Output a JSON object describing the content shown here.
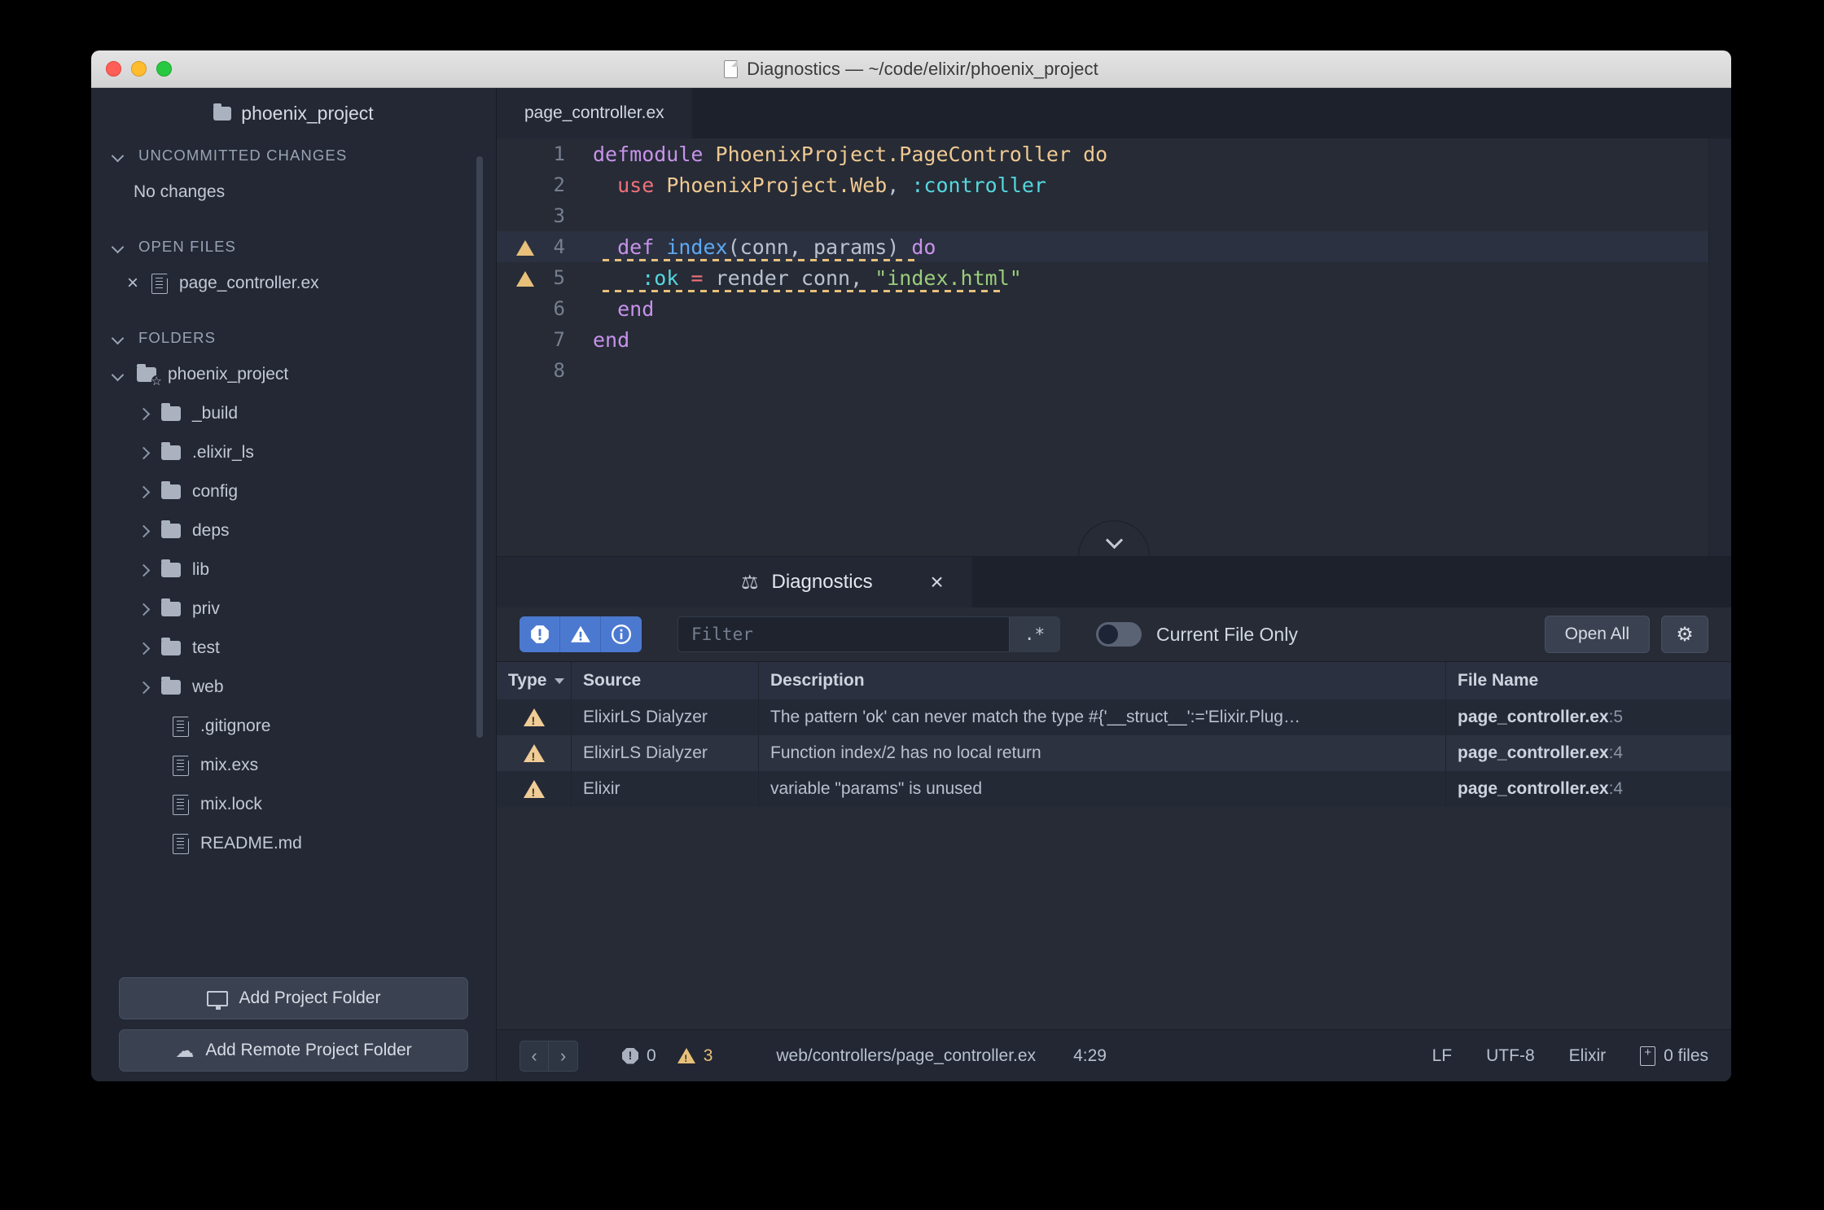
{
  "window": {
    "title": "Diagnostics — ~/code/elixir/phoenix_project",
    "traffic": {
      "close": "close",
      "minimize": "minimize",
      "zoom": "zoom"
    }
  },
  "sidebar": {
    "project_name": "phoenix_project",
    "sections": [
      {
        "label": "UNCOMMITTED CHANGES",
        "empty_text": "No changes"
      },
      {
        "label": "OPEN FILES"
      },
      {
        "label": "FOLDERS"
      }
    ],
    "open_files": [
      {
        "name": "page_controller.ex",
        "close": "×"
      }
    ],
    "root_folder": "phoenix_project",
    "folders": [
      "_build",
      ".elixir_ls",
      "config",
      "deps",
      "lib",
      "priv",
      "test",
      "web"
    ],
    "files": [
      ".gitignore",
      "mix.exs",
      "mix.lock",
      "README.md"
    ],
    "buttons": [
      {
        "label": "Add Project Folder",
        "icon": "monitor-icon"
      },
      {
        "label": "Add Remote Project Folder",
        "icon": "cloud-upload-icon"
      }
    ]
  },
  "editor": {
    "tabs": [
      {
        "label": "page_controller.ex",
        "active": true
      }
    ],
    "lines": [
      {
        "n": "1",
        "marker": "",
        "highlight": false,
        "tokens": [
          {
            "t": "defmodule ",
            "c": "tok-kw"
          },
          {
            "t": "PhoenixProject.PageController",
            "c": "tok-mod"
          },
          {
            "t": " ",
            "c": "tok-punc"
          },
          {
            "t": "do",
            "c": "tok-mod"
          }
        ]
      },
      {
        "n": "2",
        "marker": "",
        "highlight": false,
        "tokens": [
          {
            "t": "  ",
            "c": "tok-punc"
          },
          {
            "t": "use ",
            "c": "tok-use"
          },
          {
            "t": "PhoenixProject.Web",
            "c": "tok-mod"
          },
          {
            "t": ", ",
            "c": "tok-punc"
          },
          {
            "t": ":controller",
            "c": "tok-atom"
          }
        ]
      },
      {
        "n": "3",
        "marker": "",
        "highlight": false,
        "tokens": []
      },
      {
        "n": "4",
        "marker": "warning",
        "highlight": true,
        "squiggle": true,
        "tokens": [
          {
            "t": "  ",
            "c": "tok-punc"
          },
          {
            "t": "def ",
            "c": "tok-kw"
          },
          {
            "t": "index",
            "c": "tok-fn"
          },
          {
            "t": "(conn, params) ",
            "c": "tok-punc"
          },
          {
            "t": "do",
            "c": "tok-kw"
          }
        ]
      },
      {
        "n": "5",
        "marker": "warning",
        "highlight": false,
        "squiggle": true,
        "tokens": [
          {
            "t": "    ",
            "c": "tok-punc"
          },
          {
            "t": ":ok",
            "c": "tok-atom"
          },
          {
            "t": " = ",
            "c": "tok-op"
          },
          {
            "t": "render conn, ",
            "c": "tok-punc"
          },
          {
            "t": "\"index.html\"",
            "c": "tok-str"
          }
        ]
      },
      {
        "n": "6",
        "marker": "",
        "highlight": false,
        "tokens": [
          {
            "t": "  ",
            "c": "tok-punc"
          },
          {
            "t": "end",
            "c": "tok-kw"
          }
        ]
      },
      {
        "n": "7",
        "marker": "",
        "highlight": false,
        "tokens": [
          {
            "t": "end",
            "c": "tok-kw"
          }
        ]
      },
      {
        "n": "8",
        "marker": "",
        "highlight": false,
        "tokens": []
      }
    ]
  },
  "panel": {
    "tab_label": "Diagnostics",
    "tab_icon": "scales-icon",
    "close_label": "×",
    "collapse_icon": "chevron-down-icon",
    "severity_filters": [
      {
        "name": "error",
        "icon": "error-octagon-icon",
        "active": true
      },
      {
        "name": "warning",
        "icon": "warning-triangle-icon",
        "active": true
      },
      {
        "name": "info",
        "icon": "info-circle-icon",
        "active": true
      }
    ],
    "filter_placeholder": "Filter",
    "filter_value": "",
    "regex_label": ".*",
    "current_file_only_label": "Current File Only",
    "current_file_only_on": false,
    "open_all_label": "Open All",
    "settings_icon": "gear-icon",
    "table": {
      "columns": [
        "Type",
        "Source",
        "Description",
        "File Name"
      ],
      "sorted_column": "Type",
      "rows": [
        {
          "type": "warning",
          "source": "ElixirLS Dialyzer",
          "description": "The pattern 'ok' can never match the type #{'__struct__':='Elixir.Plug…",
          "file": "page_controller.ex",
          "line": ":5"
        },
        {
          "type": "warning",
          "source": "ElixirLS Dialyzer",
          "description": "Function index/2 has no local return",
          "file": "page_controller.ex",
          "line": ":4"
        },
        {
          "type": "warning",
          "source": "Elixir",
          "description": "variable \"params\" is unused",
          "file": "page_controller.ex",
          "line": ":4"
        }
      ]
    }
  },
  "statusbar": {
    "nav_back": "‹",
    "nav_forward": "›",
    "error_count": "0",
    "warning_count": "3",
    "path": "web/controllers/page_controller.ex",
    "cursor": "4:29",
    "line_ending": "LF",
    "encoding": "UTF-8",
    "language": "Elixir",
    "files_count": "0 files"
  },
  "colors": {
    "accent_blue": "#4c79d0",
    "warning": "#e8c07a",
    "window_bg": "#262b36",
    "sidebar_bg": "#232834"
  }
}
